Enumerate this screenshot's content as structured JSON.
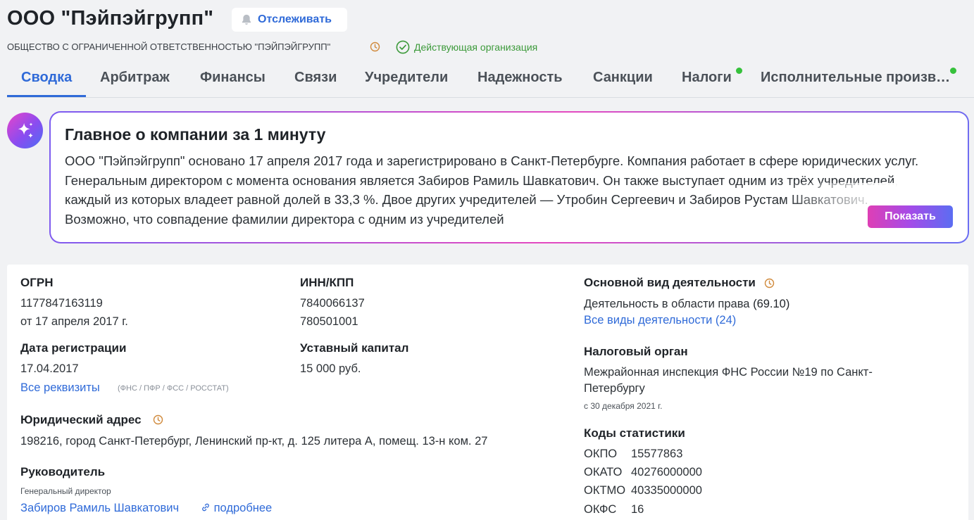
{
  "header": {
    "company_title": "ООО \"Пэйпэйгрупп\"",
    "track_label": "Отслеживать",
    "legal_name": "ОБЩЕСТВО С ОГРАНИЧЕННОЙ ОТВЕТСТВЕННОСТЬЮ \"ПЭЙПЭЙГРУПП\"",
    "status": "Действующая организация"
  },
  "tabs": [
    {
      "label": "Сводка",
      "active": true,
      "dot": false
    },
    {
      "label": "Арбитраж",
      "active": false,
      "dot": false
    },
    {
      "label": "Финансы",
      "active": false,
      "dot": false
    },
    {
      "label": "Связи",
      "active": false,
      "dot": false
    },
    {
      "label": "Учредители",
      "active": false,
      "dot": false
    },
    {
      "label": "Надежность",
      "active": false,
      "dot": false
    },
    {
      "label": "Санкции",
      "active": false,
      "dot": false
    },
    {
      "label": "Налоги",
      "active": false,
      "dot": true
    },
    {
      "label": "Исполнительные произв…",
      "active": false,
      "dot": true
    }
  ],
  "summary": {
    "title": "Главное о компании за 1 минуту",
    "text": "ООО \"Пэйпэйгрупп\" основано 17 апреля 2017 года и зарегистрировано в Санкт-Петербурге. Компания работает в сфере юридических услуг. Генеральным директором с момента основания является Забиров Рамиль Шавкатович. Он также выступает одним из трёх учредителей, каждый из которых владеет равной долей в 33,3 %. Двое других учредителей — Утробин Сергеевич и Забиров Рустам Шавкатович. Возможно, что совпадение фамилии директора с одним из учредителей",
    "show_label": "Показать"
  },
  "details": {
    "ogrn": {
      "label": "ОГРН",
      "value": "1177847163119",
      "date": "от 17 апреля 2017 г."
    },
    "inn_kpp": {
      "label": "ИНН/КПП",
      "inn": "7840066137",
      "kpp": "780501001"
    },
    "registration": {
      "label": "Дата регистрации",
      "value": "17.04.2017"
    },
    "capital": {
      "label": "Уставный капитал",
      "value": "15 000 руб."
    },
    "all_requisites": {
      "link": "Все реквизиты",
      "sources": "(ФНС / ПФР / ФСС / РОССТАТ)"
    },
    "address": {
      "label": "Юридический адрес",
      "value": "198216, город Санкт-Петербург, Ленинский пр-кт, д. 125 литера А, помещ. 13-н ком. 27"
    },
    "director": {
      "label": "Руководитель",
      "position": "Генеральный директор",
      "name": "Забиров Рамиль Шавкатович",
      "more": "подробнее"
    },
    "activity": {
      "label": "Основной вид деятельности",
      "value": "Деятельность в области права",
      "code": "(69.10)",
      "all_link": "Все виды деятельности (24)"
    },
    "tax": {
      "label": "Налоговый орган",
      "line1": "Межрайонная инспекция ФНС России №19 по Санкт-",
      "line2": "Петербургу",
      "since": "с 30 декабря 2021 г."
    },
    "stats": {
      "label": "Коды статистики",
      "rows": [
        {
          "code": "ОКПО",
          "value": "15577863"
        },
        {
          "code": "ОКАТО",
          "value": "40276000000"
        },
        {
          "code": "ОКТМО",
          "value": "40335000000"
        },
        {
          "code": "ОКФС",
          "value": "16"
        }
      ]
    }
  },
  "colors": {
    "accent": "#2f6ad8",
    "status_green": "#3c9a3a",
    "dot_green": "#36c13b",
    "clock_orange": "#d08a3c"
  }
}
